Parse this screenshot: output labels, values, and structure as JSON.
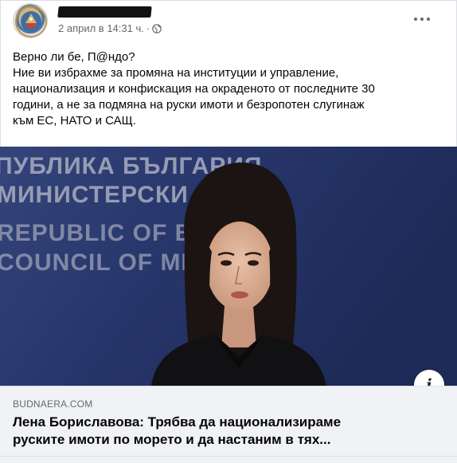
{
  "post": {
    "author_name": "",
    "timestamp": "2 април в 14:31 ч.",
    "separator": "·",
    "privacy_icon": "globe-icon",
    "more_icon": "more-horizontal-icon",
    "text_lines": [
      "Верно ли бе, П@ндо?",
      "Ние ви избрахме за промяна на институции и управление,",
      "национализация и конфискация на окраденото от последните 30",
      "години, а не за подмяна на руски имоти и безропотен слугинаж",
      "към ЕС, НАТО и САЩ."
    ]
  },
  "media": {
    "background_text": [
      "ПУБЛИКА БЪЛГАРИЯ",
      "МИНИСТЕРСКИ СЪВЕТ",
      "REPUBLIC OF BU",
      "COUNCIL OF MI"
    ],
    "info_icon": "info-icon",
    "info_label": "i"
  },
  "link_preview": {
    "domain": "BUDNAERA.COM",
    "title_lines": [
      "Лена Бориславова: Трябва да национализираме",
      "руските имоти по морето и да настаним в тях..."
    ]
  },
  "colors": {
    "text_primary": "#050505",
    "text_secondary": "#65676b",
    "card_background": "#f0f2f5",
    "backdrop_blue": "#27366a"
  }
}
